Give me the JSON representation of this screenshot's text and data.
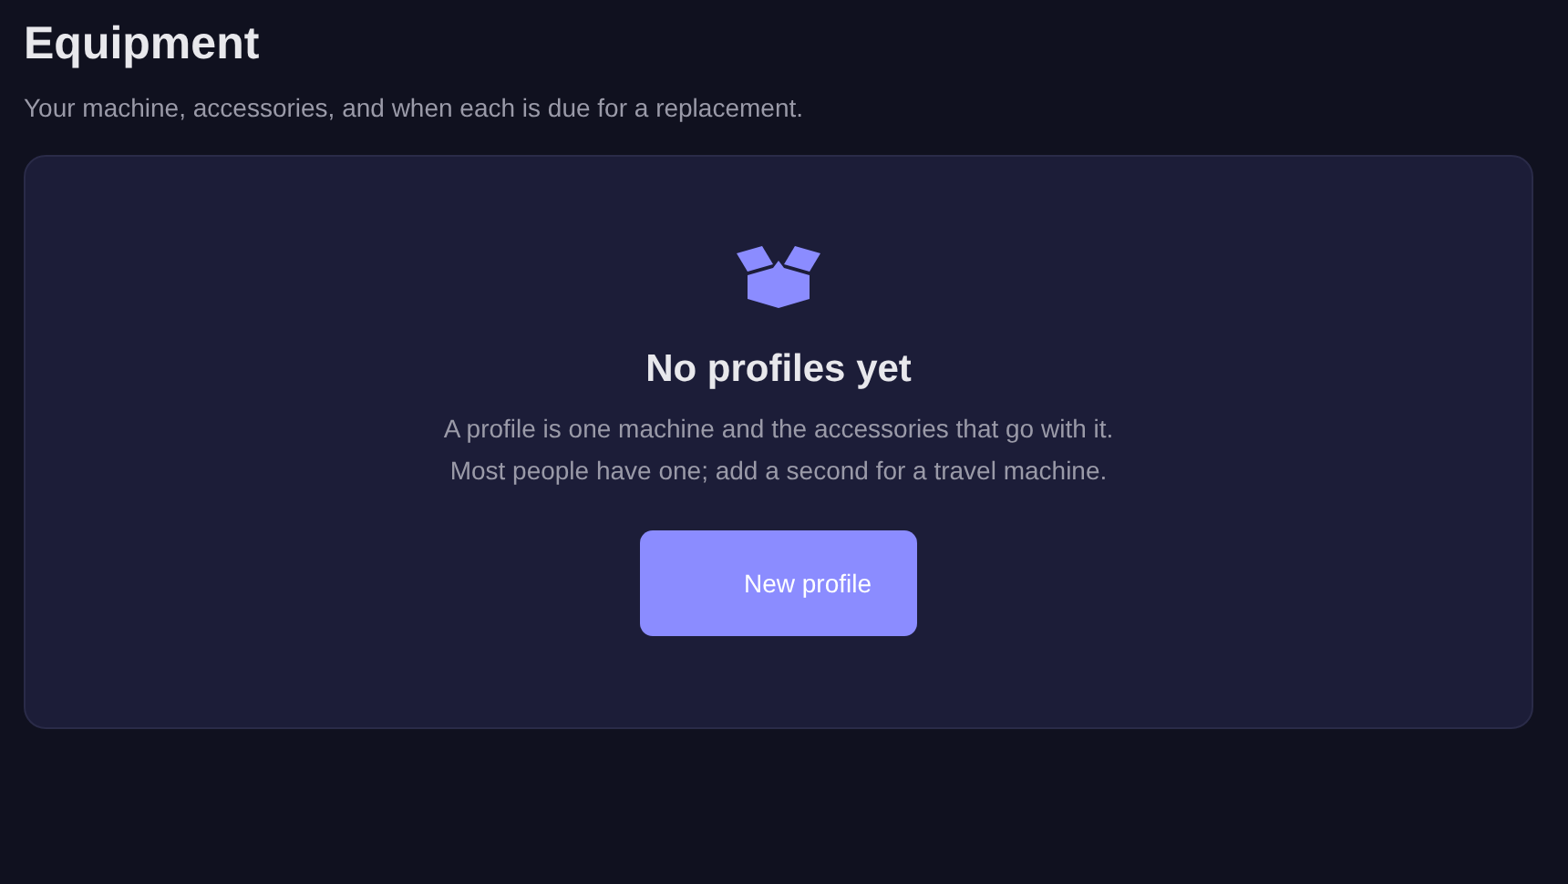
{
  "header": {
    "title": "Equipment",
    "subtitle": "Your machine, accessories, and when each is due for a replacement."
  },
  "empty_state": {
    "title": "No profiles yet",
    "lines": [
      "A profile is one machine and the accessories that go with it.",
      "Most people have one; add a second for a travel machine."
    ],
    "button": "New profile"
  }
}
